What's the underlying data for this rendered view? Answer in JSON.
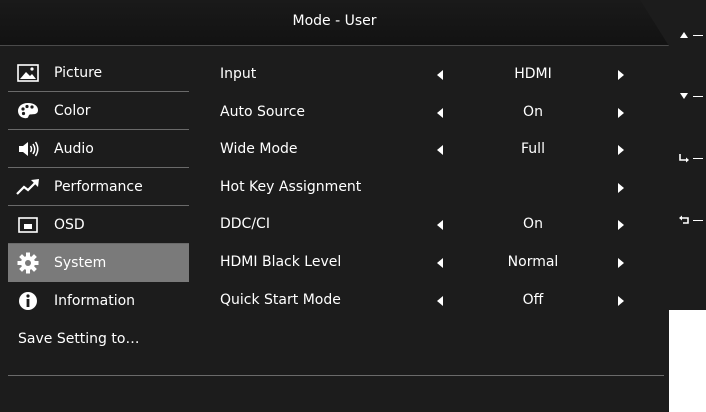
{
  "header": {
    "title": "Mode - User"
  },
  "sidebar": {
    "items": [
      {
        "label": "Picture",
        "icon": "picture-icon"
      },
      {
        "label": "Color",
        "icon": "palette-icon"
      },
      {
        "label": "Audio",
        "icon": "speaker-icon"
      },
      {
        "label": "Performance",
        "icon": "trend-arrow-icon"
      },
      {
        "label": "OSD",
        "icon": "osd-window-icon"
      },
      {
        "label": "System",
        "icon": "gear-icon",
        "selected": true
      },
      {
        "label": "Information",
        "icon": "info-icon"
      }
    ],
    "save_label": "Save Setting to…"
  },
  "options": [
    {
      "label": "Input",
      "value": "HDMI",
      "left_arrow": true,
      "right_arrow": true
    },
    {
      "label": "Auto Source",
      "value": "On",
      "left_arrow": true,
      "right_arrow": true
    },
    {
      "label": "Wide Mode",
      "value": "Full",
      "left_arrow": true,
      "right_arrow": true
    },
    {
      "label": "Hot Key Assignment",
      "value": "",
      "left_arrow": false,
      "right_arrow": true
    },
    {
      "label": "DDC/CI",
      "value": "On",
      "left_arrow": true,
      "right_arrow": true
    },
    {
      "label": "HDMI Black Level",
      "value": "Normal",
      "left_arrow": true,
      "right_arrow": true
    },
    {
      "label": "Quick Start Mode",
      "value": "Off",
      "left_arrow": true,
      "right_arrow": true
    }
  ],
  "keys": [
    {
      "icon": "up-arrow-icon"
    },
    {
      "icon": "down-arrow-icon"
    },
    {
      "icon": "enter-icon"
    },
    {
      "icon": "back-icon"
    }
  ],
  "colors": {
    "background": "#1c1c1c",
    "selected": "#7a7a7a",
    "divider": "#6a6a6a",
    "text": "#ffffff"
  }
}
